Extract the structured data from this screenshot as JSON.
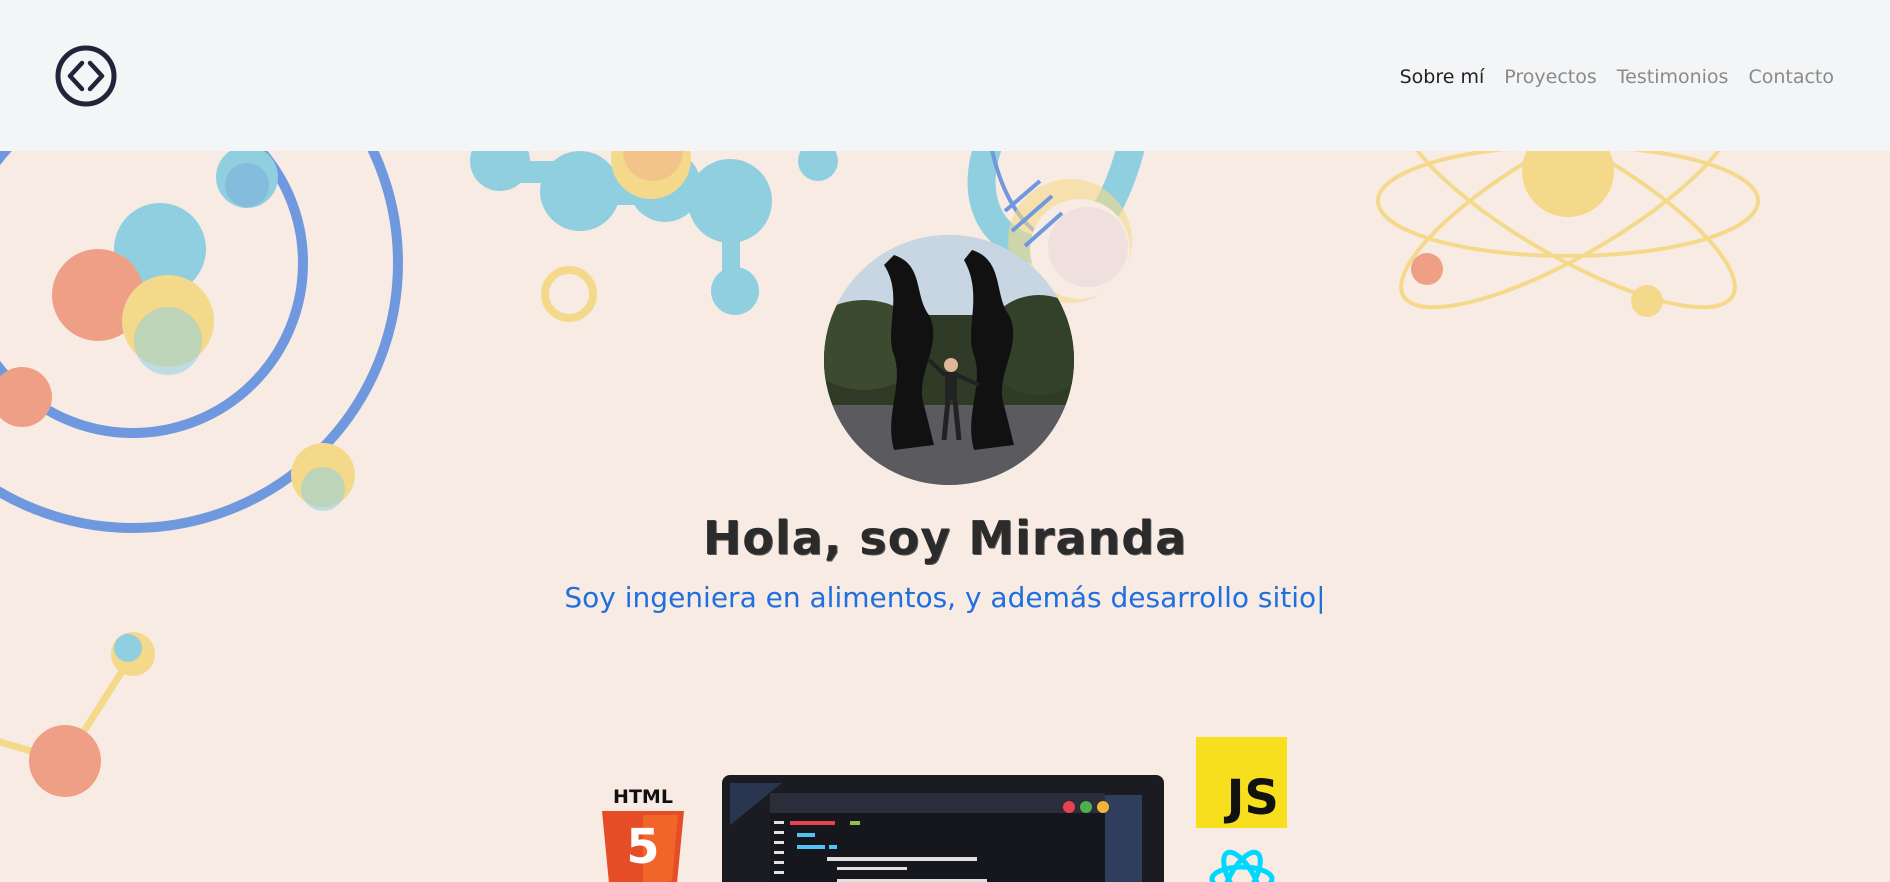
{
  "nav": {
    "logo_icon": "code-brackets-icon",
    "links": [
      {
        "label": "Sobre mí",
        "active": true
      },
      {
        "label": "Proyectos",
        "active": false
      },
      {
        "label": "Testimonios",
        "active": false
      },
      {
        "label": "Contacto",
        "active": false
      }
    ]
  },
  "hero": {
    "title": "Hola, soy Miranda",
    "subtitle": "Soy ingeniera en alimentos, y además desarrollo sitio",
    "cursor": "|"
  },
  "tech_logos": {
    "html_label": "HTML",
    "html_number": "5",
    "js_label": "JS"
  },
  "colors": {
    "nav_bg": "#f4f5f7",
    "hero_bg": "#f7ebe4",
    "accent_blue": "#1f6fe0",
    "orbit_blue": "#6f98de",
    "peach": "#ef9f86",
    "yellow": "#f5d98b",
    "teal": "#8fcfdf",
    "html_orange": "#e44d26",
    "js_yellow": "#f7df1e"
  }
}
